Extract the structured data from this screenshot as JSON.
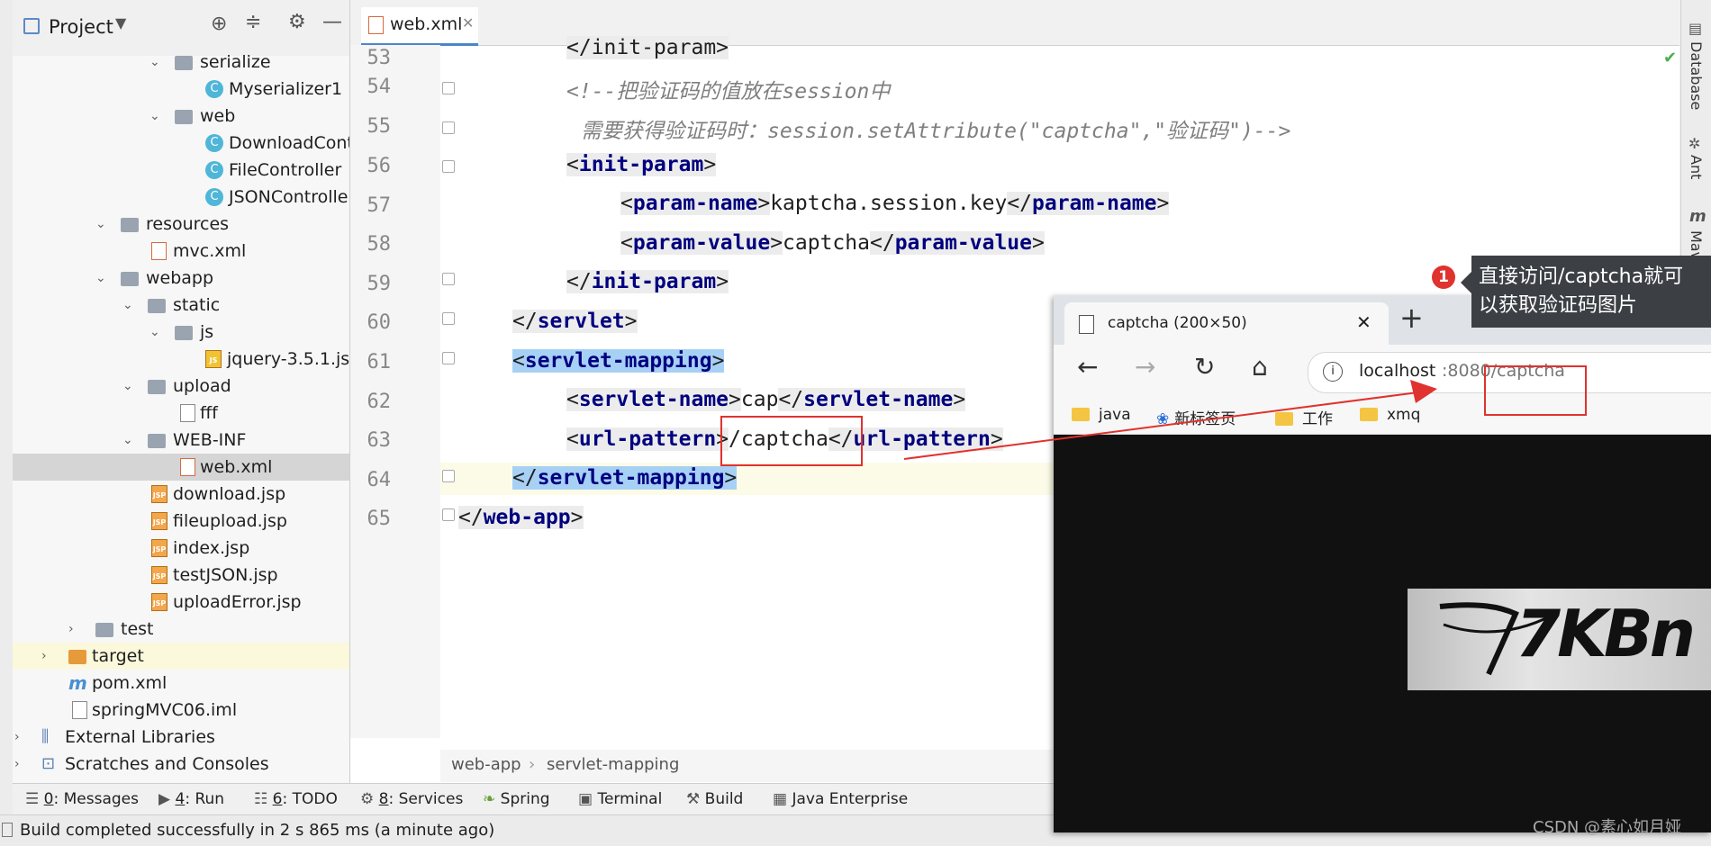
{
  "project_panel": {
    "title": "Project",
    "tree": [
      {
        "label": "serialize",
        "icon": "folder-icon"
      },
      {
        "label": "Myserializer1",
        "icon": "class-icon"
      },
      {
        "label": "web",
        "icon": "folder-icon"
      },
      {
        "label": "DownloadContr",
        "icon": "class-icon"
      },
      {
        "label": "FileController",
        "icon": "class-icon"
      },
      {
        "label": "JSONController",
        "icon": "class-icon"
      },
      {
        "label": "resources",
        "icon": "folder-icon"
      },
      {
        "label": "mvc.xml",
        "icon": "xml-file-icon"
      },
      {
        "label": "webapp",
        "icon": "folder-icon"
      },
      {
        "label": "static",
        "icon": "folder-icon"
      },
      {
        "label": "js",
        "icon": "folder-icon"
      },
      {
        "label": "jquery-3.5.1.js",
        "icon": "js-file-icon"
      },
      {
        "label": "upload",
        "icon": "folder-icon"
      },
      {
        "label": "fff",
        "icon": "file-icon"
      },
      {
        "label": "WEB-INF",
        "icon": "folder-icon"
      },
      {
        "label": "web.xml",
        "icon": "xml-file-icon"
      },
      {
        "label": "download.jsp",
        "icon": "jsp-file-icon"
      },
      {
        "label": "fileupload.jsp",
        "icon": "jsp-file-icon"
      },
      {
        "label": "index.jsp",
        "icon": "jsp-file-icon"
      },
      {
        "label": "testJSON.jsp",
        "icon": "jsp-file-icon"
      },
      {
        "label": "uploadError.jsp",
        "icon": "jsp-file-icon"
      },
      {
        "label": "test",
        "icon": "folder-icon"
      },
      {
        "label": "target",
        "icon": "folder-icon"
      },
      {
        "label": "pom.xml",
        "icon": "maven-icon"
      },
      {
        "label": "springMVC06.iml",
        "icon": "module-file-icon"
      },
      {
        "label": "External Libraries",
        "icon": "library-icon"
      },
      {
        "label": "Scratches and Consoles",
        "icon": "scratches-icon"
      }
    ]
  },
  "editor": {
    "tab_label": "web.xml",
    "line_numbers": [
      "53",
      "54",
      "55",
      "56",
      "57",
      "58",
      "59",
      "60",
      "61",
      "62",
      "63",
      "64",
      "65"
    ],
    "lines": {
      "l53": "</init-param>",
      "l54": "<!--把验证码的值放在session中",
      "l55": "需要获得验证码时：session.setAttribute(\"captcha\",\"验证码\")-->",
      "l56_tag": "init-param",
      "l57_tag": "param-name",
      "l57_text": "kaptcha.session.key",
      "l58_tag": "param-value",
      "l58_text": "captcha",
      "l59_tag": "init-param",
      "l60_tag": "servlet",
      "l61_tag": "servlet-mapping",
      "l62_tag": "servlet-name",
      "l62_text": "cap",
      "l63_tag": "url-pattern",
      "l63_text": "/captcha",
      "l64_tag": "servlet-mapping",
      "l65_tag": "web-app"
    },
    "breadcrumb": [
      "web-app",
      "servlet-mapping"
    ]
  },
  "right_tools": [
    "Database",
    "Ant",
    "Maven"
  ],
  "bottom_tabs": [
    {
      "key": "0",
      "label": ": Messages"
    },
    {
      "key": "4",
      "label": ": Run"
    },
    {
      "key": "6",
      "label": ": TODO"
    },
    {
      "key": "8",
      "label": ": Services"
    },
    {
      "key": "",
      "label": "Spring"
    },
    {
      "key": "",
      "label": "Terminal"
    },
    {
      "key": "",
      "label": "Build"
    },
    {
      "key": "",
      "label": "Java Enterprise"
    }
  ],
  "status": "Build completed successfully in 2 s 865 ms (a minute ago)",
  "browser": {
    "tab_title": "captcha (200×50)",
    "url_host": "localhost",
    "url_rest": ":8080/captcha",
    "bookmarks": [
      "java",
      "新标签页",
      "工作",
      "xmq"
    ],
    "captcha_text": "7KBn"
  },
  "annotation": {
    "badge": "1",
    "text_line1": "直接访问/captcha就可",
    "text_line2": "以获取验证码图片"
  },
  "watermark": "CSDN @素心如月娅",
  "colors": {
    "tag": "#00007f",
    "selection": "#a7d0f5",
    "annotation_red": "#e0322e"
  }
}
